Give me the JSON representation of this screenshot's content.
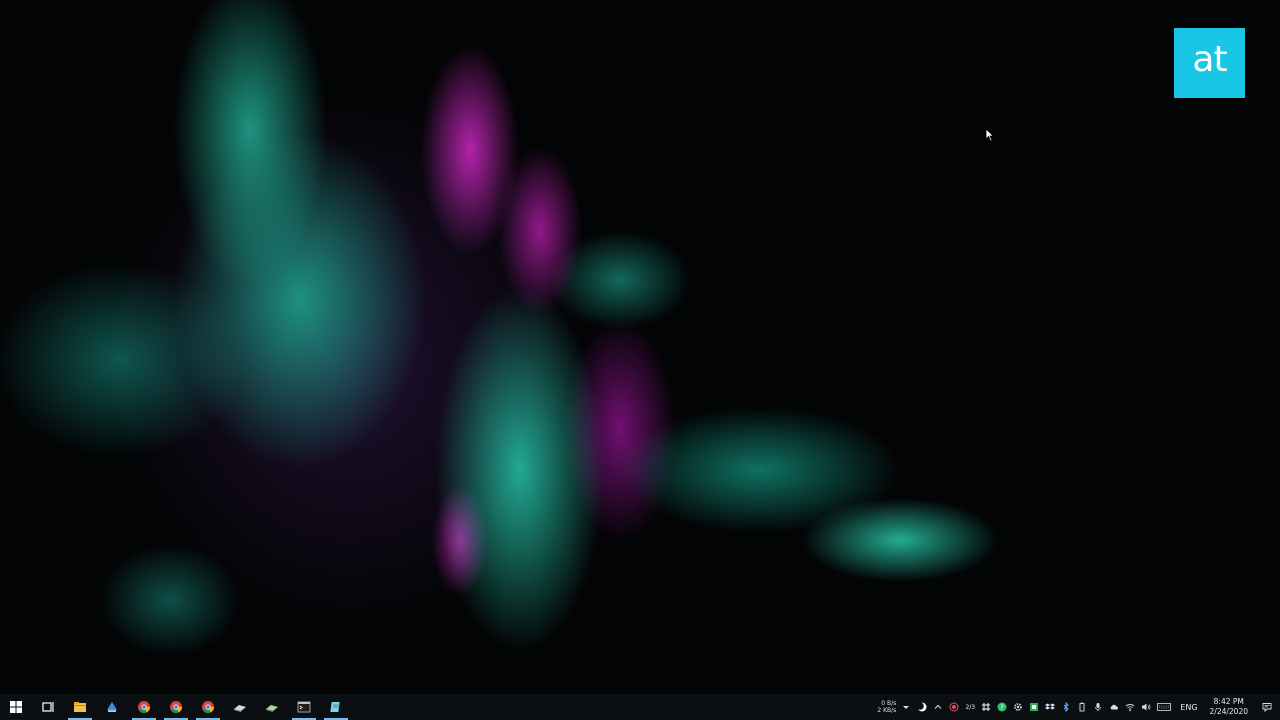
{
  "desktop": {
    "brand_logo_text": "at",
    "accent_colors": {
      "teal": "#28c8aa",
      "magenta": "#d228c8",
      "logo": "#19c6e6"
    }
  },
  "taskbar": {
    "pinned": [
      {
        "name": "start-button",
        "icon": "windows-logo-icon"
      },
      {
        "name": "task-view-button",
        "icon": "task-view-icon"
      },
      {
        "name": "file-explorer-button",
        "icon": "folder-icon",
        "active": true
      },
      {
        "name": "app-blue-button",
        "icon": "app-icon"
      },
      {
        "name": "chrome-button-1",
        "icon": "chrome-icon",
        "active": true
      },
      {
        "name": "chrome-button-2",
        "icon": "chrome-icon",
        "active": true
      },
      {
        "name": "chrome-button-3",
        "icon": "chrome-icon",
        "active": true
      },
      {
        "name": "app-gray-button",
        "icon": "app-icon"
      },
      {
        "name": "app-green-button",
        "icon": "app-icon"
      },
      {
        "name": "terminal-button",
        "icon": "terminal-icon",
        "active": true
      },
      {
        "name": "notepad-button",
        "icon": "notepad-icon",
        "active": true
      }
    ],
    "tray": {
      "upload_speed": "0 B/s",
      "download_speed": "2 KB/s",
      "counter": "2/3",
      "language": "ENG",
      "time": "8:42 PM",
      "date": "2/24/2020"
    }
  }
}
